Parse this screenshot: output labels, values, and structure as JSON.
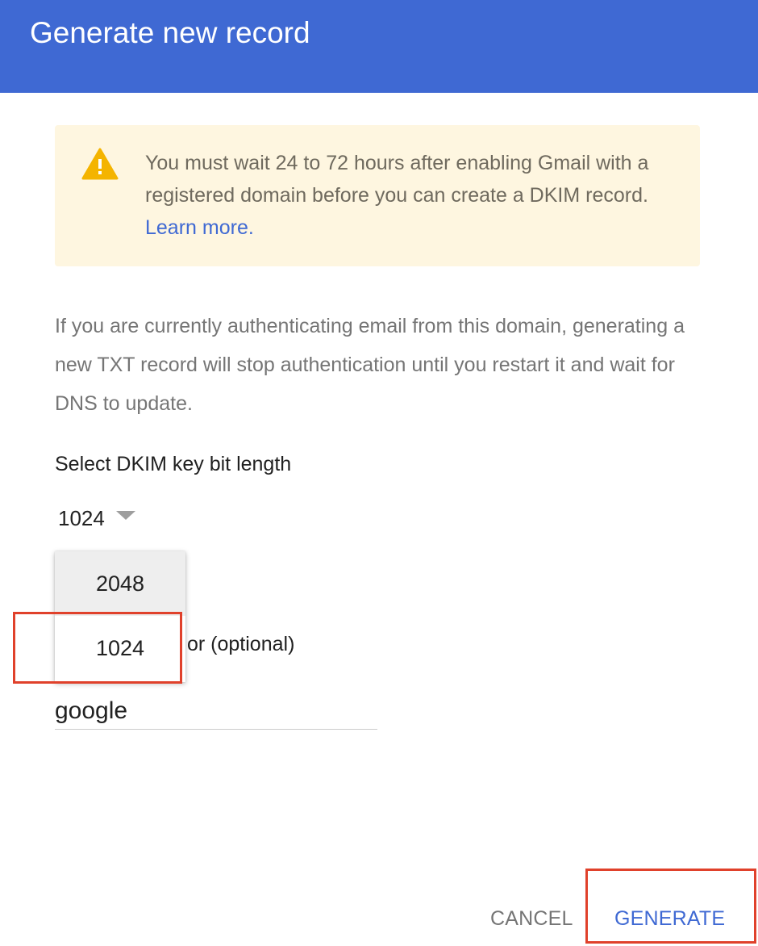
{
  "dialog": {
    "title": "Generate new record"
  },
  "warning": {
    "icon": "warning-icon",
    "text": "You must wait 24 to 72 hours after enabling Gmail with a registered domain before you can create a DKIM record.",
    "link_label": "Learn more."
  },
  "info": {
    "text": "If you are currently authenticating email from this domain, generating a new TXT record will stop authentication until you restart it and wait for DNS to update."
  },
  "key_length": {
    "label": "Select DKIM key bit length",
    "selected": "1024",
    "options": [
      "2048",
      "1024"
    ]
  },
  "selector": {
    "label_visible": "or (optional)",
    "value": "google"
  },
  "actions": {
    "cancel_label": "CANCEL",
    "generate_label": "GENERATE"
  },
  "colors": {
    "header": "#3f69d3",
    "warning_bg": "#fef6e0",
    "warning_icon": "#f4b400",
    "link": "#3f69d3",
    "annotation": "#e0412b"
  }
}
